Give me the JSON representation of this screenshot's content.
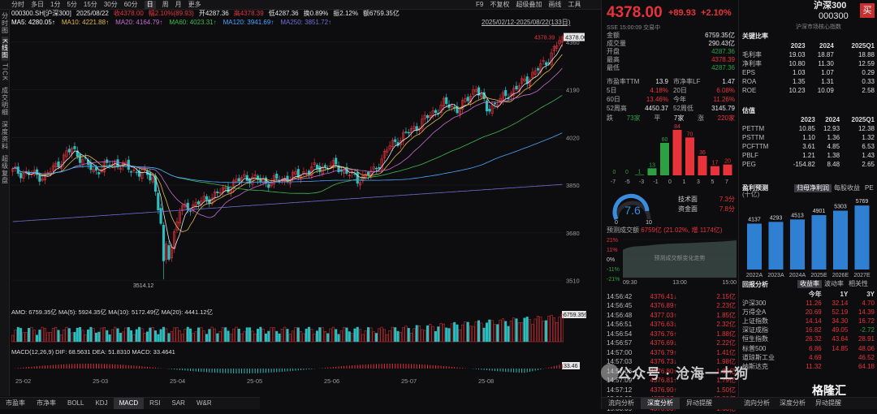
{
  "topbar": {
    "periods": [
      "分时",
      "多日",
      "1分",
      "5分",
      "15分",
      "30分",
      "60分",
      "日",
      "周",
      "月",
      "更多"
    ],
    "active_period": "日",
    "right_items": [
      "F9",
      "不复权",
      "超级叠加",
      "画线",
      "工具"
    ]
  },
  "sidetabs": [
    "分时图",
    "K线图",
    "TICK",
    "成交明细",
    "深度资料",
    "超级复盘"
  ],
  "chart_header": {
    "code": "000300.SH[沪深300]",
    "date": "2025/08/22",
    "close_label": "收4378.00",
    "change_label": "幅2.10%(89.93)",
    "open_label": "开4287.36",
    "high_label": "高4378.39",
    "low_label": "低4287.36",
    "turnover_label": "换0.89%",
    "amplitude_label": "振2.12%",
    "amount_label": "额6759.35亿",
    "range": "2025/02/12-2025/08/22(133日)"
  },
  "ma_row": [
    {
      "label": "MA5",
      "value": "4280.05↑",
      "color": "#ffffff"
    },
    {
      "label": "MA10",
      "value": "4221.88↑",
      "color": "#e0b84c"
    },
    {
      "label": "MA20",
      "value": "4164.79↑",
      "color": "#c46bd0"
    },
    {
      "label": "MA60",
      "value": "4023.31↑",
      "color": "#3fb950"
    },
    {
      "label": "MA120",
      "value": "3941.69↑",
      "color": "#4aa3ff"
    },
    {
      "label": "MA250",
      "value": "3851.72↑",
      "color": "#6f6fd8"
    }
  ],
  "colors": {
    "up": "#e8333b",
    "down": "#2bbfbf",
    "ma5": "#e6e6e6",
    "ma10": "#e0b84c",
    "ma20": "#c46bd0",
    "ma60": "#3fb950",
    "ma120": "#4aa3ff",
    "ma250": "#6f6fd8"
  },
  "kline": {
    "price_ticks": [
      "4360",
      "4190",
      "4020",
      "3850",
      "3680",
      "3510"
    ],
    "price_tag": "4378.00",
    "high_mark": "4378.39",
    "low_mark": "3514.12",
    "x_labels": [
      "25-02",
      "25-03",
      "25-04",
      "25-05",
      "25-06",
      "25-07",
      "25-08"
    ],
    "amo_label": "AMO: 6759.35亿 MA(5): 5924.35亿 MA(10): 5172.49亿 MA(20): 4441.12亿",
    "amo_tag": "6759.35亿",
    "macd_label": "MACD(12,26,9) DIF: 68.5631 DEA: 51.8310 MACD: 33.4641",
    "macd_tag": "33.46"
  },
  "bottom_tabs": [
    "市盈率",
    "市净率",
    "BOLL",
    "KDJ",
    "MACD",
    "RSI",
    "SAR",
    "W&R"
  ],
  "bottom_active": "MACD",
  "quote": {
    "price": "4378.00",
    "change": "+89.93",
    "pct": "+2.10%",
    "sse_line": "SSE 15:00:09 交易中",
    "rows": [
      {
        "k": "金额",
        "v": "6759.35亿",
        "c": "white"
      },
      {
        "k": "成交量",
        "v": "290.43亿",
        "c": "white"
      },
      {
        "k": "开盘",
        "v": "4287.36",
        "c": "green"
      },
      {
        "k": "最高",
        "v": "4378.39",
        "c": "red"
      },
      {
        "k": "最低",
        "v": "4287.36",
        "c": "green"
      }
    ],
    "pe": {
      "k": "市盈率TTM",
      "v": "13.9",
      "k2": "市净率LF",
      "v2": "1.47"
    },
    "d5": {
      "k": "5日",
      "v": "4.18%",
      "k2": "20日",
      "v2": "6.08%"
    },
    "d60": {
      "k": "60日",
      "v": "13.46%",
      "k2": "今年",
      "v2": "11.26%"
    },
    "w52": {
      "k": "52周高",
      "v": "4450.37",
      "k2": "52周低",
      "v2": "3145.79"
    },
    "breadth": {
      "down_label": "跌",
      "down": "73家",
      "flat_label": "平",
      "flat": "7家",
      "up_label": "涨",
      "up": "220家"
    }
  },
  "distribution": {
    "bins": [
      "-7",
      "-5",
      "-3",
      "-1",
      "0",
      "1",
      "3",
      "5",
      "7"
    ],
    "values": [
      0,
      0,
      1,
      13,
      60,
      84,
      70,
      36,
      17,
      20
    ],
    "labels": [
      "-7",
      "-5",
      "-3",
      "-1",
      "0",
      "1",
      "3",
      "5",
      "7"
    ]
  },
  "score": {
    "value": "7.6",
    "min": "0",
    "max": "10",
    "tech_label": "技术面",
    "tech": "7.3分",
    "fund_label": "资金面",
    "fund": "7.8分"
  },
  "prediction": {
    "label": "预测成交额",
    "value": "6759亿 (21.02%, 增 1174亿)",
    "ticks": [
      "21%",
      "11%",
      "0%",
      "-11%",
      "-21%"
    ],
    "x_labels": [
      "09:30",
      "13:00",
      "15:00"
    ],
    "hint": "预测成交额变化走势"
  },
  "ticks": [
    {
      "t": "14:56:42",
      "p": "4376.41",
      "v": "2.15亿",
      "dir": "↓"
    },
    {
      "t": "14:56:45",
      "p": "4376.89",
      "v": "2.23亿",
      "dir": "↑"
    },
    {
      "t": "14:56:48",
      "p": "4377.03",
      "v": "1.85亿",
      "dir": "↑"
    },
    {
      "t": "14:56:51",
      "p": "4376.63",
      "v": "2.32亿",
      "dir": "↓"
    },
    {
      "t": "14:56:54",
      "p": "4376.76",
      "v": "1.88亿",
      "dir": "↑"
    },
    {
      "t": "14:56:57",
      "p": "4376.69",
      "v": "2.22亿",
      "dir": "↓"
    },
    {
      "t": "14:57:00",
      "p": "4376.79",
      "v": "1.41亿",
      "dir": "↑"
    },
    {
      "t": "14:57:03",
      "p": "4376.73",
      "v": "1.98亿",
      "dir": "↓"
    },
    {
      "t": "14:57:06",
      "p": "4376.80",
      "v": "1.85亿",
      "dir": "↑"
    },
    {
      "t": "14:57:09",
      "p": "4376.81",
      "v": "1.79亿",
      "dir": "↑"
    },
    {
      "t": "14:57:12",
      "p": "4376.90",
      "v": "1.50亿",
      "dir": "↑"
    },
    {
      "t": "15:00:03",
      "p": "4377.97",
      "v": "49.80亿",
      "dir": "↑"
    },
    {
      "t": "15:00:09",
      "p": "4378.00",
      "v": "1.63亿",
      "dir": "↑"
    }
  ],
  "mid_tabs": [
    "流向分析",
    "深度分析",
    "异动提醒"
  ],
  "mid_active": "深度分析",
  "right": {
    "name": "沪深300",
    "code": "000300",
    "buy": "买",
    "sub": "沪深市场核心指数",
    "key_title": "关键比率",
    "key_cols": [
      "",
      "2023",
      "2024",
      "2025Q1"
    ],
    "key_rows": [
      [
        "毛利率",
        "19.03",
        "18.87",
        "18.88"
      ],
      [
        "净利率",
        "10.80",
        "11.30",
        "12.59"
      ],
      [
        "EPS",
        "1.03",
        "1.07",
        "0.29"
      ],
      [
        "ROA",
        "1.35",
        "1.31",
        "0.33"
      ],
      [
        "ROE",
        "10.23",
        "10.09",
        "2.58"
      ]
    ],
    "val_title": "估值",
    "val_cols": [
      "",
      "2023",
      "2024",
      "2025Q1"
    ],
    "val_rows": [
      [
        "PETTM",
        "10.85",
        "12.93",
        "12.38"
      ],
      [
        "PSTTM",
        "1.10",
        "1.36",
        "1.32"
      ],
      [
        "PCFTTM",
        "3.61",
        "4.85",
        "6.53"
      ],
      [
        "PBLF",
        "1.21",
        "1.38",
        "1.43"
      ],
      [
        "PEG",
        "-154.82",
        "8.48",
        "2.65"
      ]
    ],
    "profit_title": "盈利预测",
    "profit_unit": "(十亿)",
    "profit_tabs": [
      "归母净利润",
      "每股收益",
      "PE"
    ],
    "profit_active": "归母净利润",
    "profit_years": [
      "2022A",
      "2023A",
      "2024A",
      "2025E",
      "2026E",
      "2027E"
    ],
    "profit_values": [
      4137,
      4293,
      4513,
      4901,
      5303,
      5769
    ],
    "return_title": "回报分析",
    "return_tabs": [
      "收益率",
      "波动率",
      "相关性"
    ],
    "return_active": "收益率",
    "return_cols": [
      "",
      "今年",
      "1Y",
      "3Y"
    ],
    "return_rows": [
      [
        "沪深300",
        "11.26",
        "32.14",
        "4.70"
      ],
      [
        "万得全A",
        "20.69",
        "52.19",
        "14.39"
      ],
      [
        "上证指数",
        "14.14",
        "34.30",
        "16.72"
      ],
      [
        "深证成指",
        "16.82",
        "49.05",
        "-2.72"
      ],
      [
        "恒生指数",
        "26.32",
        "43.64",
        "28.91"
      ],
      [
        "标普500",
        "6.86",
        "14.85",
        "48.06"
      ],
      [
        "道琼斯工业",
        "4.69",
        "",
        "46.52"
      ],
      [
        "纳斯达克",
        "11.32",
        "",
        "64.18"
      ]
    ],
    "bottom_tabs": [
      "流向分析",
      "深度分析",
      "异动提醒"
    ]
  },
  "watermark": "公众号 · 沧海一土狗",
  "logo": "格隆汇"
}
